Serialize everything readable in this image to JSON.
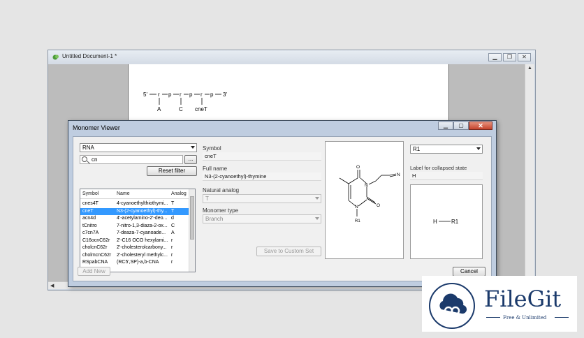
{
  "document": {
    "title": "Untitled Document-1 *",
    "sequence": {
      "five_prime": "5'",
      "three_prime": "3'",
      "backbone": [
        "r",
        "p",
        "r",
        "p",
        "r",
        "p"
      ],
      "bases": [
        "A",
        "C",
        "cneT"
      ]
    }
  },
  "dialog": {
    "title": "Monomer Viewer",
    "polymer_type": "RNA",
    "search_value": "cn",
    "browse_label": "...",
    "reset_filter_label": "Reset filter",
    "table": {
      "headers": [
        "Symbol",
        "Name",
        "Analog"
      ],
      "rows": [
        {
          "symbol": "cnes4T",
          "name": "4-cyanoethylthiothymi...",
          "analog": "T"
        },
        {
          "symbol": "cneT",
          "name": "N3-(2-cyanoethyl)-thy...",
          "analog": "T"
        },
        {
          "symbol": "acn4d",
          "name": "4'-acetylamino-2'-deo...",
          "analog": "d"
        },
        {
          "symbol": "tCnitro",
          "name": "7-nitro-1,3-diaza-2-ox...",
          "analog": "C"
        },
        {
          "symbol": "c7cn7A",
          "name": "7-deaza-7-cyanoade...",
          "analog": "A"
        },
        {
          "symbol": "C16ocnC62r",
          "name": "2'-C16 OCO hexylami...",
          "analog": "r"
        },
        {
          "symbol": "cholcnC62r",
          "name": "2'-cholesterolcarbony...",
          "analog": "r"
        },
        {
          "symbol": "cholmcnC62r",
          "name": "2'-cholesteryl methylc...",
          "analog": "r"
        },
        {
          "symbol": "RSpabCNA",
          "name": "(RC5',SP)-a,b-CNA",
          "analog": "r"
        }
      ],
      "selected_index": 1
    },
    "add_new_label": "Add New",
    "symbol_label": "Symbol",
    "symbol_value": "cneT",
    "full_name_label": "Full name",
    "full_name_value": "N3-(2-cyanoethyl)-thymine",
    "natural_analog_label": "Natural analog",
    "natural_analog_value": "T",
    "monomer_type_label": "Monomer type",
    "monomer_type_value": "Branch",
    "save_custom_label": "Save to Custom Set",
    "r_group_value": "R1",
    "collapsed_label": "Label for collapsed state",
    "collapsed_value": "H",
    "rgroup_structure": {
      "atom": "H",
      "rgroup": "R1"
    },
    "cancel_label": "Cancel",
    "structure_atoms": {
      "o1": "O",
      "o2": "O",
      "n1": "N",
      "n2": "N",
      "n3": "N",
      "r1": "R1"
    }
  },
  "watermark": {
    "brand": "FileGit",
    "tagline": "Free & Unlimited"
  },
  "colors": {
    "selection": "#3399ff",
    "brand": "#1b3a6b",
    "close_button": "#c5442d"
  }
}
